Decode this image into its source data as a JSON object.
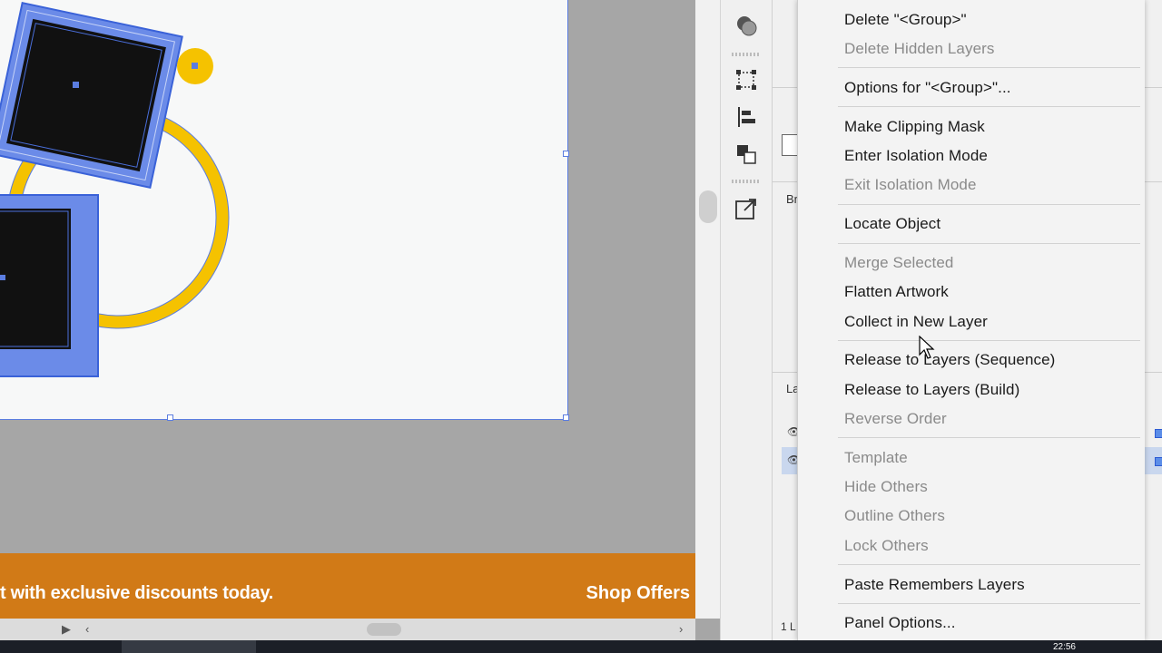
{
  "banner": {
    "text": "t with exclusive discounts today.",
    "cta": "Shop Offers"
  },
  "colors": {
    "banner": "#d17a17",
    "selection": "#5b7de0",
    "accent_yellow": "#f5c200",
    "menu_bg": "#f3f3f3",
    "menu_disabled": "#8a8a8a"
  },
  "icons": {
    "scroll_left": "‹",
    "scroll_right": "›",
    "scroll_play": "▶"
  },
  "panels": {
    "label_a": "Br",
    "label_b": "La",
    "label_c": "1 L"
  },
  "taskbar": {
    "clock": "22:56"
  },
  "context_menu": {
    "delete_group": "Delete \"<Group>\"",
    "delete_hidden_layers": "Delete Hidden Layers",
    "options_for_group": "Options for \"<Group>\"...",
    "make_clipping_mask": "Make Clipping Mask",
    "enter_isolation_mode": "Enter Isolation Mode",
    "exit_isolation_mode": "Exit Isolation Mode",
    "locate_object": "Locate Object",
    "merge_selected": "Merge Selected",
    "flatten_artwork": "Flatten Artwork",
    "collect_in_new_layer": "Collect in New Layer",
    "release_to_layers_sequence": "Release to Layers (Sequence)",
    "release_to_layers_build": "Release to Layers (Build)",
    "reverse_order": "Reverse Order",
    "template": "Template",
    "hide_others": "Hide Others",
    "outline_others": "Outline Others",
    "lock_others": "Lock Others",
    "paste_remembers_layers": "Paste Remembers Layers",
    "panel_options": "Panel Options..."
  }
}
